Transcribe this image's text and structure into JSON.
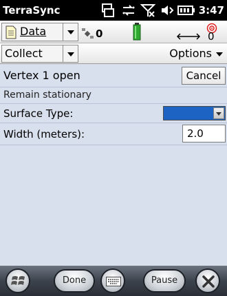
{
  "statusbar": {
    "app_title": "TerraSync",
    "time": "3:47",
    "icons": [
      "sync-icon",
      "data-connection-icon",
      "no-signal-icon",
      "volume-icon",
      "battery-icon"
    ]
  },
  "toolbar1": {
    "section": "Data",
    "satellite_count": "0",
    "battery_icon": "battery-icon",
    "gps_count": "0"
  },
  "toolbar2": {
    "mode": "Collect",
    "options_label": "Options"
  },
  "form": {
    "vertex_status": "Vertex 1 open",
    "cancel_label": "Cancel",
    "instruction": "Remain stationary",
    "surface_type_label": "Surface Type:",
    "width_label": "Width (meters):",
    "width_value": "2.0"
  },
  "softbar": {
    "done_label": "Done",
    "pause_label": "Pause"
  },
  "colors": {
    "accent": "#1c63c4",
    "content_bg": "#d8dfed",
    "status_bg": "#000000"
  }
}
